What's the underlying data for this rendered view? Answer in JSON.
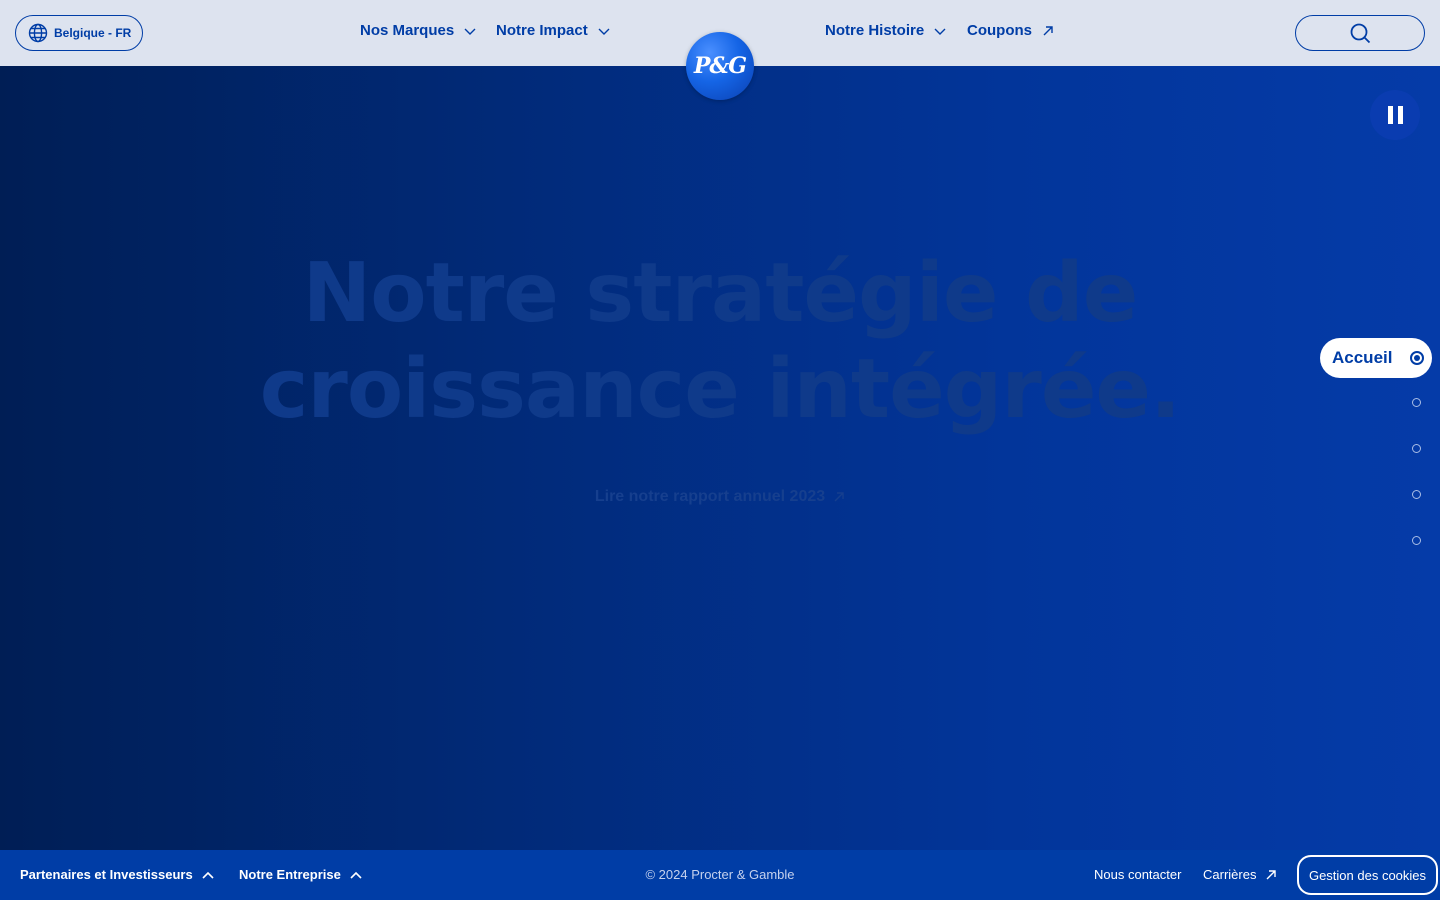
{
  "header": {
    "locale": "Belgique - FR",
    "nav": [
      {
        "label": "Nos Marques",
        "icon": "chevron-down-icon"
      },
      {
        "label": "Notre Impact",
        "icon": "chevron-down-icon"
      },
      {
        "label": "Notre Histoire",
        "icon": "chevron-down-icon"
      },
      {
        "label": "Coupons",
        "icon": "external-arrow-icon"
      }
    ],
    "search_icon": "search-icon"
  },
  "logo": {
    "text": "P&G"
  },
  "hero": {
    "headline_line1": "Notre stratégie de",
    "headline_line2": "croissance intégrée.",
    "cta_label": "Lire notre rapport annuel 2023",
    "pause_icon": "pause-icon"
  },
  "section_nav": {
    "active_label": "Accueil",
    "dot_count": 4
  },
  "footer": {
    "left": [
      {
        "label": "Partenaires et Investisseurs",
        "icon": "chevron-up-icon"
      },
      {
        "label": "Notre Entreprise",
        "icon": "chevron-up-icon"
      }
    ],
    "copyright": "© 2024 Procter & Gamble",
    "contact": "Nous contacter",
    "careers": "Carrières",
    "cookies": "Gestion des cookies"
  },
  "colors": {
    "brand_blue": "#003da6",
    "header_bg": "#dde3ef",
    "hero_dark": "#001e55",
    "hero_light": "#053ba8"
  }
}
